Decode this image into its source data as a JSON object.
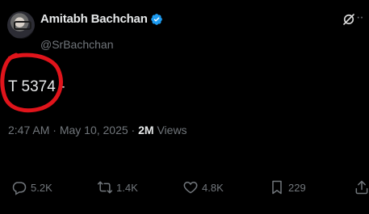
{
  "author": {
    "display_name": "Amitabh Bachchan",
    "handle": "@SrBachchan",
    "verified": true
  },
  "tweet": {
    "text": "T 5374 -"
  },
  "meta": {
    "time": "2:47 AM",
    "separator1": " · ",
    "date": "May 10, 2025",
    "separator2": " · ",
    "views_count": "2M",
    "views_label": " Views"
  },
  "actions": {
    "replies": "5.2K",
    "reposts": "1.4K",
    "likes": "4.8K",
    "bookmarks": "229"
  },
  "colors": {
    "background": "#000000",
    "text_primary": "#e7e9ea",
    "text_secondary": "#71767b",
    "verified_blue": "#1d9bf0",
    "annotation_red": "#e0141b"
  }
}
